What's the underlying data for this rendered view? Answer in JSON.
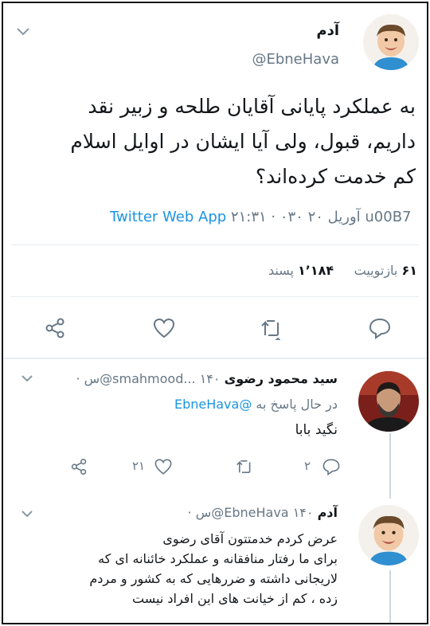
{
  "main_tweet": {
    "display_name": "آدم",
    "handle": "@EbneHava",
    "text_lines": [
      "به عملکرد پایانی آقایان طلحه و زبیر نقد",
      "داریم، قبول، ولی آیا ایشان در اوایل اسلام",
      "کم خدمت کرده‌اند؟"
    ],
    "meta_time": "۲۱:۳۱ · ۰۳۰ آوریل ۲۰ u00B7",
    "meta_source": "Twitter Web App",
    "retweet_count": "۶۱",
    "retweet_label": "بازتوییت",
    "like_count": "۱٬۱۸۴",
    "like_label": "پسند"
  },
  "reply_1": {
    "display_name": "سید محمود رضوی",
    "handle": "@smahmood...",
    "time": "۱۴۰س ·",
    "replying_prefix": "در حال پاسخ به",
    "replying_handle": "@EbneHava",
    "text": "نگید بابا",
    "like_count": "۲۱",
    "reply_count": "۲"
  },
  "reply_2": {
    "display_name": "آدم",
    "handle": "@EbneHava",
    "time": "۱۴۰س ·",
    "text_lines": [
      "عرض کردم خدمتتون آقای رضوی",
      "برای ما رفتار منافقانه و عملکرد خائنانه ای که",
      "لاریجانی داشته و ضررهایی که به کشور و مردم",
      "زده ، کم از خیانت های این افراد نیست"
    ]
  },
  "colors": {
    "text": "#14171a",
    "muted": "#657786",
    "link": "#1b95e0",
    "divider": "#e6ecf0"
  }
}
